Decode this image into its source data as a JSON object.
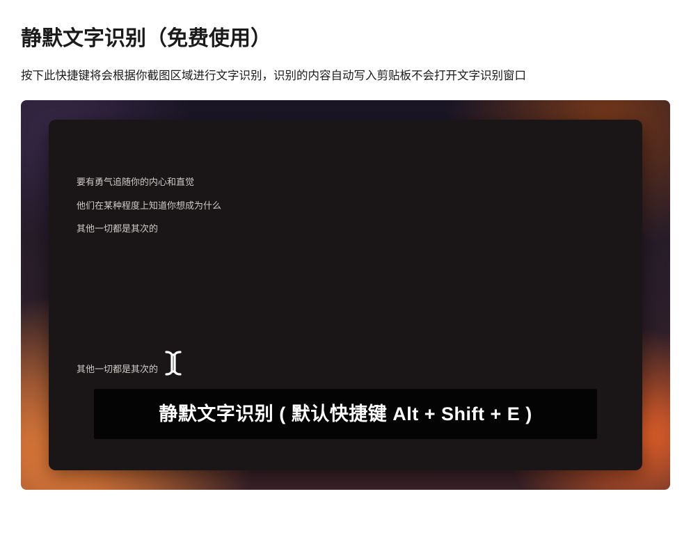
{
  "page": {
    "title": "静默文字识别（免费使用）",
    "description": "按下此快捷键将会根据你截图区域进行文字识别，识别的内容自动写入剪贴板不会打开文字识别窗口"
  },
  "editor": {
    "lines": [
      "要有勇气追随你的内心和直觉",
      "他们在某种程度上知道你想成为什么",
      "其他一切都是其次的"
    ],
    "input_text": "其他一切都是其次的"
  },
  "caption": {
    "text": "静默文字识别 ( 默认快捷键 Alt + Shift + E )"
  }
}
